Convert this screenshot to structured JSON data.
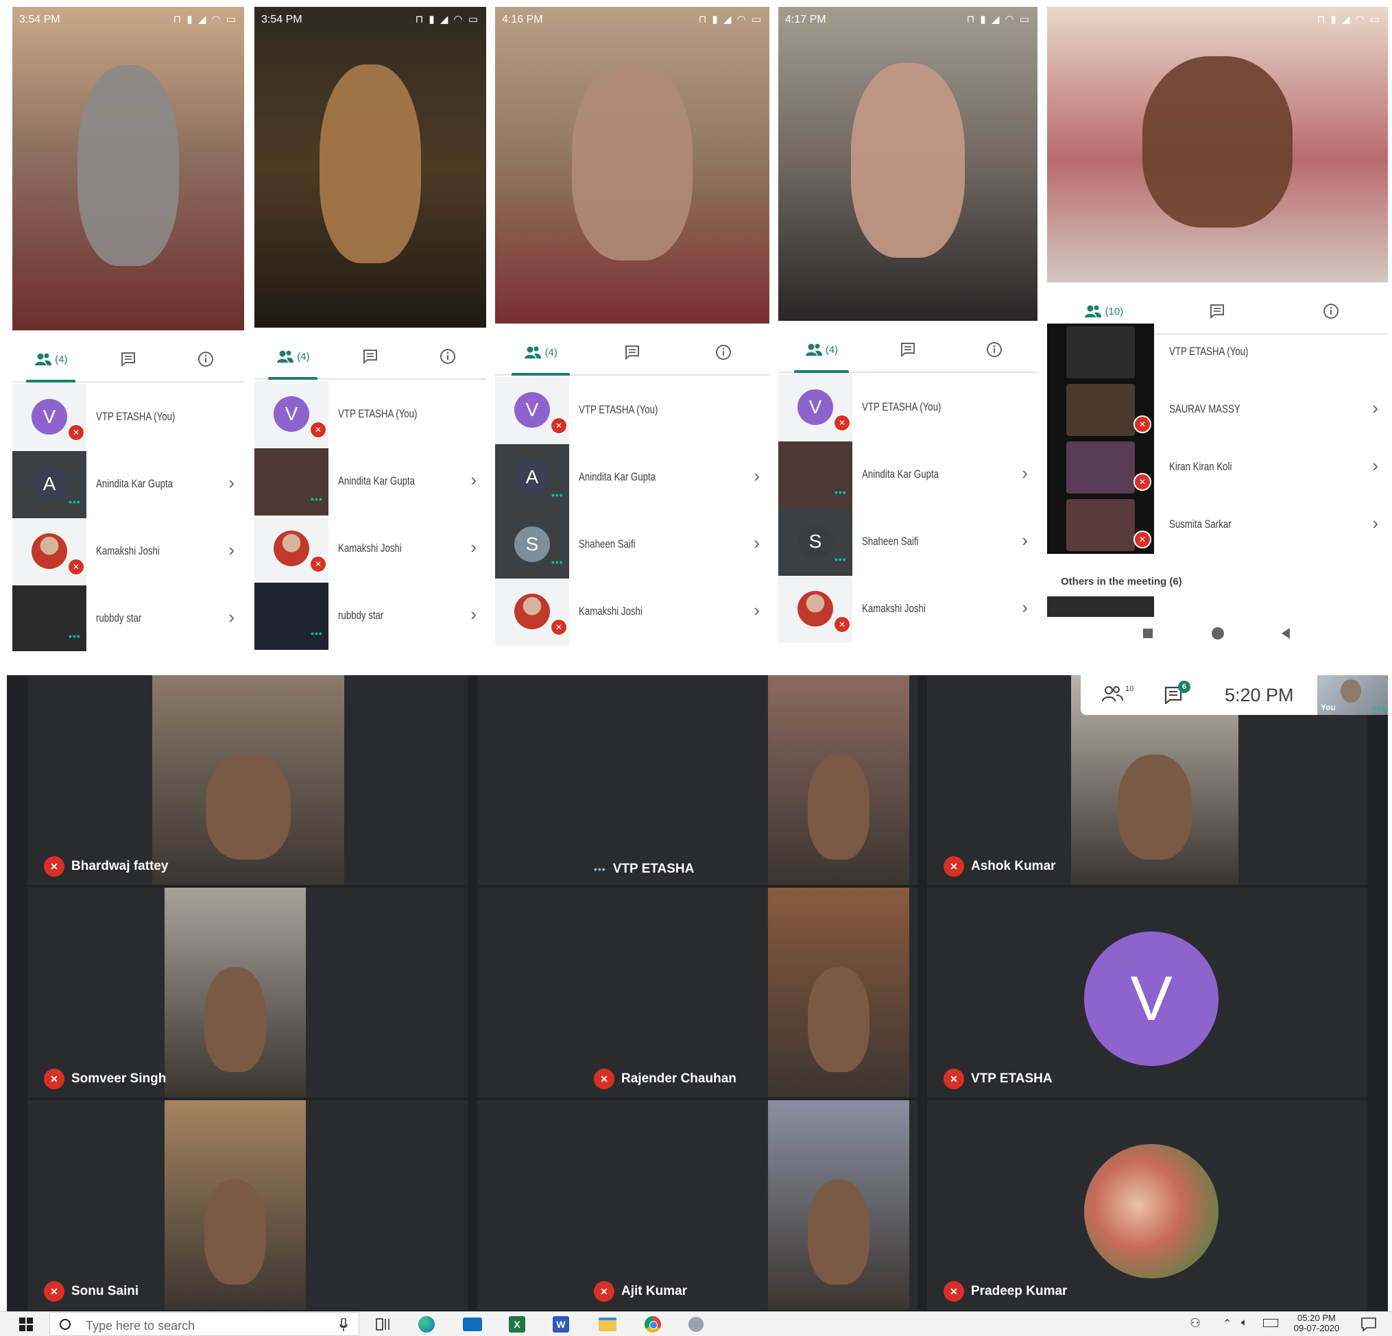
{
  "phones": [
    {
      "status_time": "3:54 PM",
      "people_count": "(4)",
      "participants": [
        {
          "name": "VTP ETASHA (You)",
          "avatar_letter": "V",
          "avatar_color": "#8e63ce"
        },
        {
          "name": "Anindita Kar Gupta",
          "avatar_letter": "A",
          "avatar_color": "#3b3f52"
        },
        {
          "name": "Kamakshi Joshi",
          "avatar_letter": "",
          "avatar_color": "#c0392b"
        },
        {
          "name": "rubbdy star",
          "avatar_letter": "",
          "avatar_color": "#2a2a2a"
        }
      ]
    },
    {
      "status_time": "3:54 PM",
      "people_count": "(4)",
      "participants": [
        {
          "name": "VTP ETASHA (You)",
          "avatar_letter": "V",
          "avatar_color": "#8e63ce"
        },
        {
          "name": "Anindita Kar Gupta",
          "avatar_letter": "",
          "avatar_color": "#4a3a33"
        },
        {
          "name": "Kamakshi Joshi",
          "avatar_letter": "",
          "avatar_color": "#c0392b"
        },
        {
          "name": "rubbdy star",
          "avatar_letter": "",
          "avatar_color": "#1f2230"
        }
      ]
    },
    {
      "status_time": "4:16 PM",
      "people_count": "(4)",
      "participants": [
        {
          "name": "VTP ETASHA (You)",
          "avatar_letter": "V",
          "avatar_color": "#8e63ce"
        },
        {
          "name": "Anindita Kar Gupta",
          "avatar_letter": "A",
          "avatar_color": "#3b3f52"
        },
        {
          "name": "Shaheen Saifi",
          "avatar_letter": "S",
          "avatar_color": "#7d8e9c"
        },
        {
          "name": "Kamakshi Joshi",
          "avatar_letter": "",
          "avatar_color": "#c0392b"
        }
      ]
    },
    {
      "status_time": "4:17 PM",
      "people_count": "(4)",
      "participants": [
        {
          "name": "VTP ETASHA (You)",
          "avatar_letter": "V",
          "avatar_color": "#8e63ce"
        },
        {
          "name": "Anindita Kar Gupta",
          "avatar_letter": "",
          "avatar_color": "#4a3a33"
        },
        {
          "name": "Shaheen Saifi",
          "avatar_letter": "S",
          "avatar_color": "#3a3d40"
        },
        {
          "name": "Kamakshi Joshi",
          "avatar_letter": "",
          "avatar_color": "#c0392b"
        }
      ]
    },
    {
      "status_time": "",
      "people_count": "(10)",
      "participants": [
        {
          "name": "VTP ETASHA (You)",
          "avatar_letter": "",
          "avatar_color": "#2c2c2c"
        },
        {
          "name": "SAURAV MASSY",
          "avatar_letter": "",
          "avatar_color": "#4a3a2e"
        },
        {
          "name": "Kiran Kiran Koli",
          "avatar_letter": "",
          "avatar_color": "#5a3b55"
        },
        {
          "name": "Susmita Sarkar",
          "avatar_letter": "",
          "avatar_color": "#5a3b3b"
        }
      ],
      "others_label": "Others in the meeting (6)"
    }
  ],
  "meet": {
    "people_count": "10",
    "chat_badge": "6",
    "time": "5:20 PM",
    "self_label": "You",
    "tiles": [
      {
        "name": "Bhardwaj fattey",
        "muted": true,
        "video_color": "#8a7a6a"
      },
      {
        "name": "VTP ETASHA",
        "muted": false,
        "video_color": "#8b6a60"
      },
      {
        "name": "Ashok Kumar",
        "muted": true,
        "video_color": "#b9b3ab"
      },
      {
        "name": "Somveer Singh",
        "muted": true,
        "video_color": "#a7a29a"
      },
      {
        "name": "Rajender Chauhan",
        "muted": true,
        "video_color": "#8b5a3e"
      },
      {
        "name": "VTP ETASHA",
        "muted": true,
        "avatar_letter": "V",
        "avatar_color": "#8e63ce"
      },
      {
        "name": "Sonu Saini",
        "muted": true,
        "video_color": "#a48460"
      },
      {
        "name": "Ajit Kumar",
        "muted": true,
        "video_color": "#8a8fa0"
      },
      {
        "name": "Pradeep Kumar",
        "muted": true,
        "avatar_color": "#a89a80"
      }
    ]
  },
  "taskbar": {
    "search_placeholder": "Type here to search",
    "clock_time": "05:20 PM",
    "clock_date": "09-07-2020"
  }
}
